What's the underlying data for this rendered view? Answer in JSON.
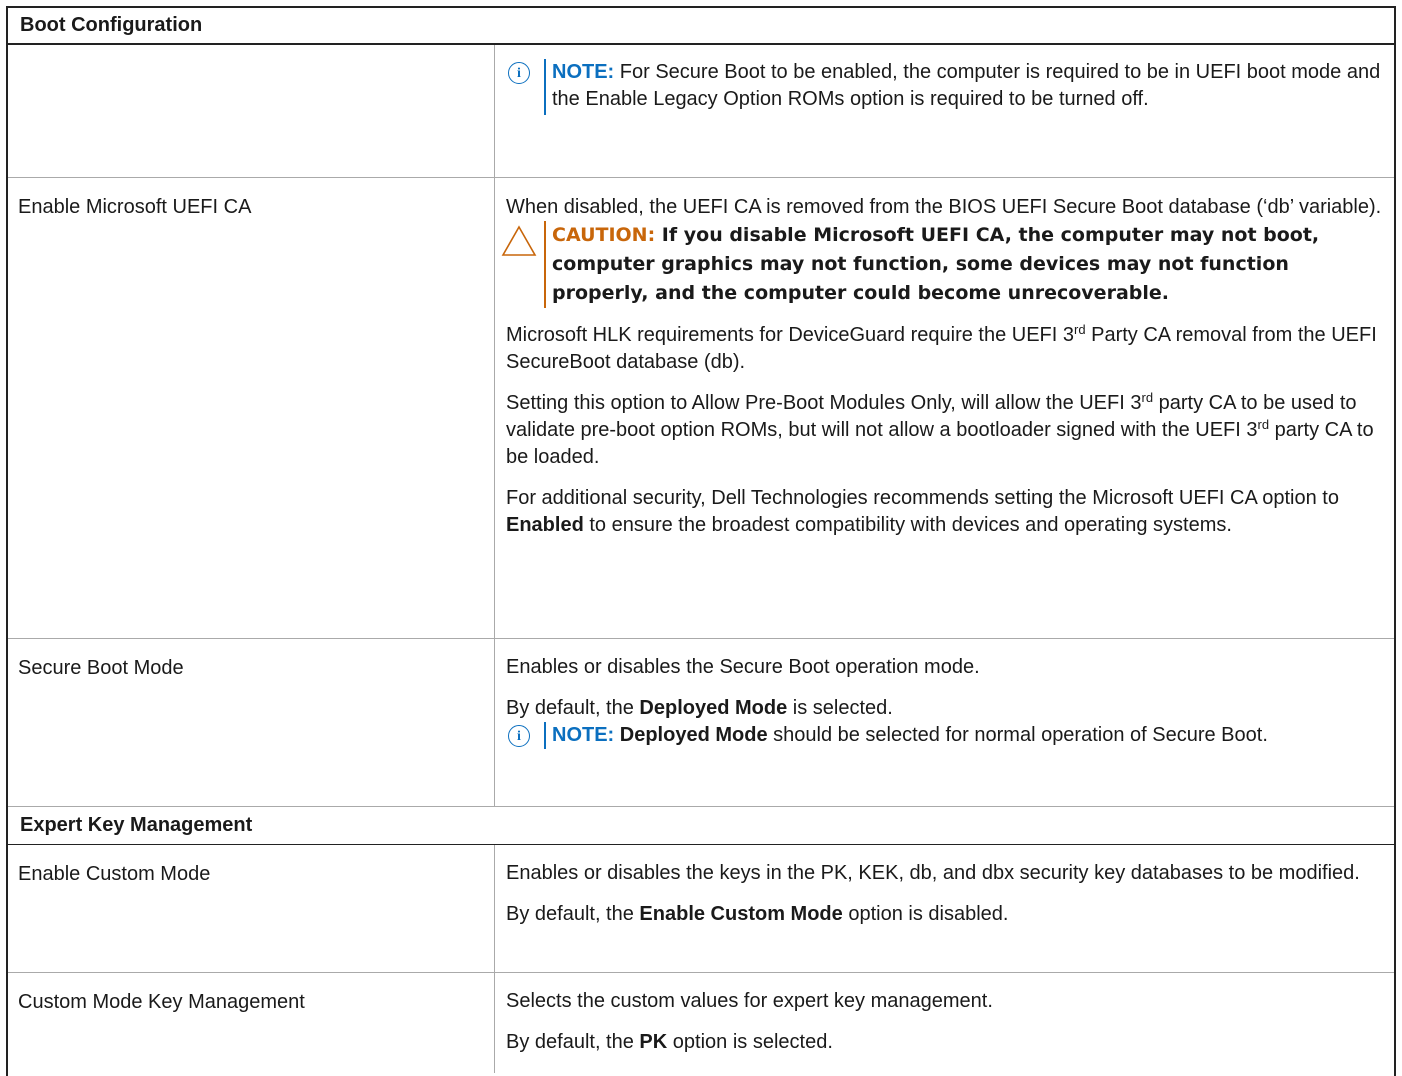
{
  "section_boot": "Boot Configuration",
  "note1": {
    "label": "NOTE:",
    "text": " For Secure Boot to be enabled, the computer is required to be in UEFI boot mode and the Enable Legacy Option ROMs option is required to be turned off."
  },
  "uefi_ca": {
    "name": "Enable Microsoft UEFI CA",
    "desc1": "When disabled, the UEFI CA is removed from the BIOS UEFI Secure Boot database (‘db’ variable).",
    "caution_label": "CAUTION:",
    "caution_text": " If you disable Microsoft UEFI CA, the computer may not boot, computer graphics may not function, some devices may not function properly, and the computer could become unrecoverable.",
    "p2_a": "Microsoft HLK requirements for DeviceGuard require the UEFI 3",
    "p2_sup": "rd",
    "p2_b": " Party CA removal from the UEFI SecureBoot database (db).",
    "p3_a": "Setting this option to Allow Pre-Boot Modules Only, will allow the UEFI 3",
    "p3_sup1": "rd",
    "p3_b": " party CA to be used to validate pre-boot option ROMs, but will not allow a bootloader signed with the UEFI 3",
    "p3_sup2": "rd",
    "p3_c": " party CA to be loaded.",
    "p4_a": "For additional security, Dell Technologies recommends setting the Microsoft UEFI CA option to ",
    "p4_bold": "Enabled",
    "p4_b": " to ensure the broadest compatibility with devices and operating systems."
  },
  "secure_boot_mode": {
    "name": "Secure Boot Mode",
    "desc1": "Enables or disables the Secure Boot operation mode.",
    "default_a": "By default, the ",
    "default_bold": "Deployed Mode",
    "default_b": " is selected.",
    "note_label": "NOTE:",
    "note_bold": " Deployed Mode",
    "note_text": " should be selected for normal operation of Secure Boot."
  },
  "section_expert": "Expert Key Management",
  "custom_mode": {
    "name": "Enable Custom Mode",
    "desc1": "Enables or disables the keys in the PK, KEK, db, and dbx security key databases to be modified.",
    "default_a": "By default, the ",
    "default_bold": "Enable Custom Mode",
    "default_b": " option is disabled."
  },
  "custom_key_mgmt": {
    "name": "Custom Mode Key Management",
    "desc1": "Selects the custom values for expert key management.",
    "default_a": "By default, the ",
    "default_bold": "PK",
    "default_b": " option is selected."
  },
  "colors": {
    "note_blue": "#0b6fbf",
    "caution_orange": "#c8660a"
  },
  "icons": {
    "note": "info-circle-icon",
    "caution": "warning-triangle-icon"
  }
}
